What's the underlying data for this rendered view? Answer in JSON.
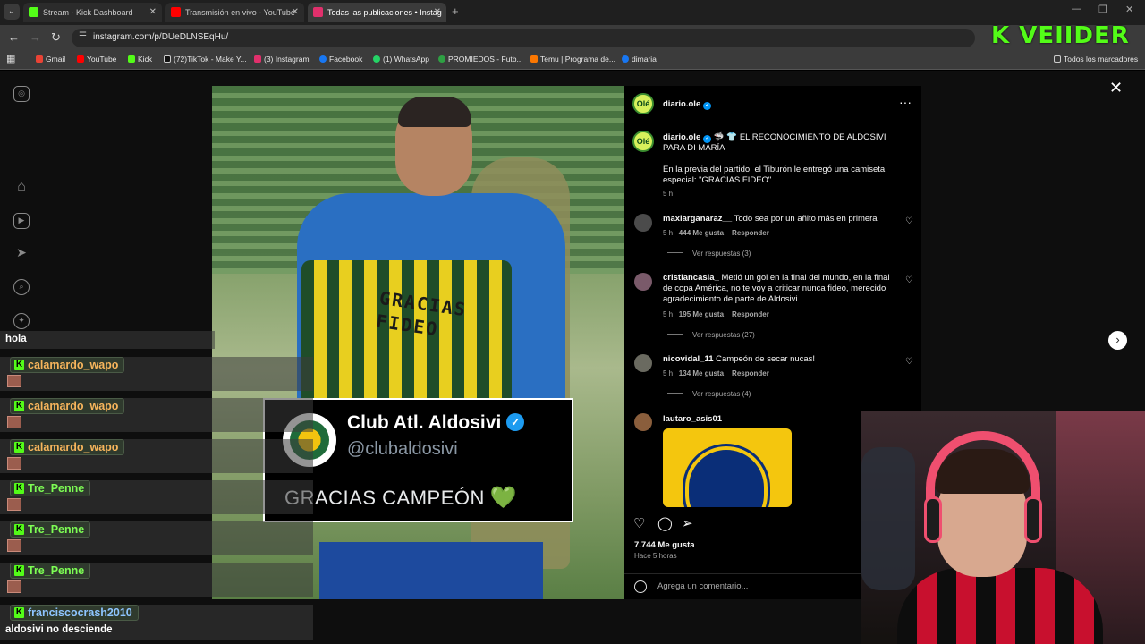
{
  "browser": {
    "tabs": [
      {
        "title": "Stream - Kick Dashboard",
        "color": "#53fc18",
        "active": false
      },
      {
        "title": "Transmisión en vivo - YouTube",
        "color": "#ff0000",
        "active": false
      },
      {
        "title": "Todas las publicaciones • Instag",
        "color": "#e1306c",
        "active": true
      }
    ],
    "url": "instagram.com/p/DUeDLNSEqHu/",
    "bookmarks": [
      {
        "label": "Gmail",
        "color": "#ea4335"
      },
      {
        "label": "YouTube",
        "color": "#ff0000"
      },
      {
        "label": "Kick",
        "color": "#53fc18"
      },
      {
        "label": "(72)TikTok - Make Y...",
        "color": "#111111"
      },
      {
        "label": "(3) Instagram",
        "color": "#e1306c"
      },
      {
        "label": "Facebook",
        "color": "#1877f2"
      },
      {
        "label": "(1) WhatsApp",
        "color": "#25d366"
      },
      {
        "label": "PROMIEDOS - Futb...",
        "color": "#2ea043"
      },
      {
        "label": "Temu | Programa de...",
        "color": "#fb7701"
      },
      {
        "label": "dimaria",
        "color": "#1877f2"
      }
    ],
    "all_bookmarks": "Todos los marcadores"
  },
  "overlay_logo": "K VEIIDER",
  "post": {
    "author": "diario.ole",
    "avatar_text": "Olé",
    "caption_title": "EL RECONOCIMIENTO DE ALDOSIVI PARA DI MARÍA",
    "caption_emojis": "🦈 👕",
    "caption_body": "En la previa del partido, el Tiburón le entregó una camiseta especial: \"GRACIAS FIDEO\"",
    "caption_time": "5 h",
    "likes": "7.744 Me gusta",
    "posted": "Hace 5 horas",
    "comment_placeholder": "Agrega un comentario...",
    "comments": [
      {
        "user": "maxiarganaraz__",
        "text": "Todo sea por un añito más en primera",
        "time": "5 h",
        "likes": "444 Me gusta",
        "reply": "Responder",
        "replies": "Ver respuestas (3)",
        "avatar": "#4b4b4b"
      },
      {
        "user": "cristiancasla_",
        "text": "Metió un gol en la final del mundo, en la final de copa América, no te voy a criticar nunca fideo, merecido agradecimiento de parte de Aldosivi.",
        "time": "5 h",
        "likes": "195 Me gusta",
        "reply": "Responder",
        "replies": "Ver respuestas (27)",
        "avatar": "#7a5a6a"
      },
      {
        "user": "nicovidal_11",
        "text": "Campeón de secar nucas!",
        "time": "5 h",
        "likes": "134 Me gusta",
        "reply": "Responder",
        "replies": "Ver respuestas (4)",
        "avatar": "#6a6a60"
      },
      {
        "user": "lautaro_asis01",
        "avatar": "#8a5e3c"
      }
    ]
  },
  "image": {
    "shirt_text_line1": "GRACIAS",
    "shirt_text_line2": "FIDEO",
    "tweet_name": "Club Atl. Aldosivi",
    "tweet_handle": "@clubaldosivi",
    "tweet_text": "GRACIAS CAMPEÓN",
    "tweet_heart": "💚"
  },
  "chat": {
    "top_message": "hola",
    "entries": [
      {
        "user": "calamardo_wapo",
        "style": "orange"
      },
      {
        "user": "calamardo_wapo",
        "style": "orange"
      },
      {
        "user": "calamardo_wapo",
        "style": "orange"
      },
      {
        "user": "Tre_Penne",
        "style": "green"
      },
      {
        "user": "Tre_Penne",
        "style": "green"
      },
      {
        "user": "Tre_Penne",
        "style": "green"
      },
      {
        "user": "franciscocrash2010",
        "style": "blue"
      }
    ],
    "bottom_message": "aldosivi no desciende"
  }
}
